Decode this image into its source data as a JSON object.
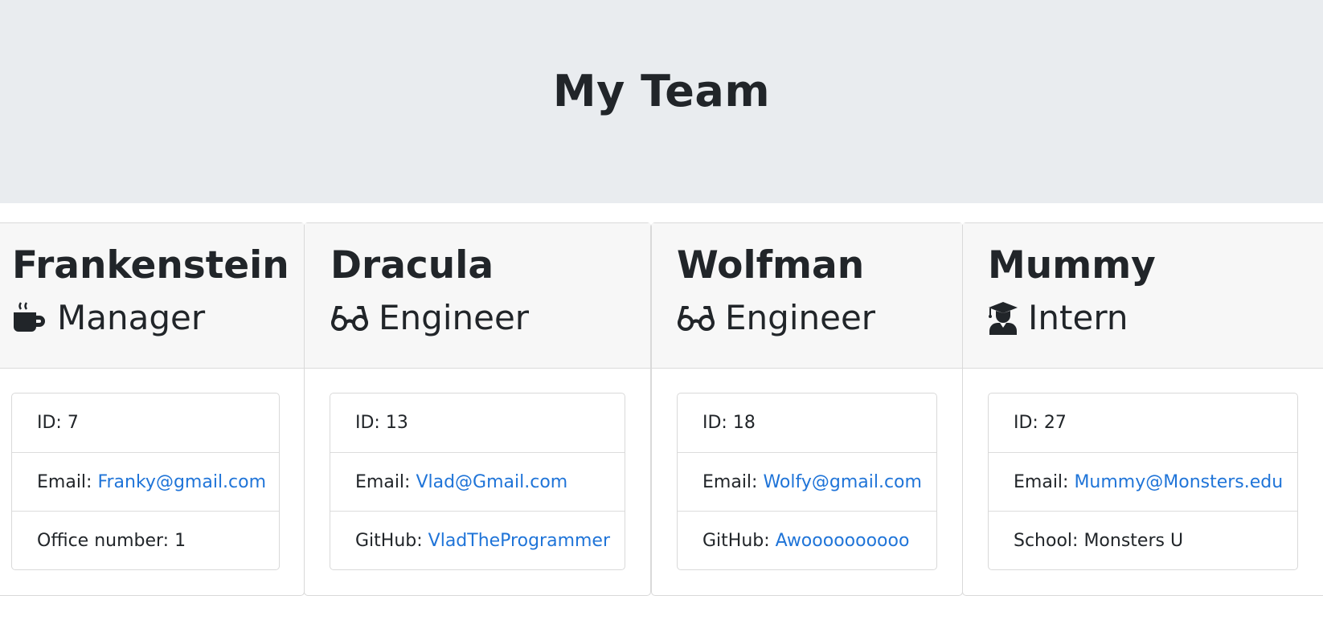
{
  "header": {
    "title": "My Team"
  },
  "employees": [
    {
      "name": "Frankenstein",
      "role": "Manager",
      "icon": "mug-icon",
      "id_text": "ID: 7",
      "email_label": "Email:",
      "email": "Franky@gmail.com",
      "extra_label": "Office number: 1",
      "extra_link": ""
    },
    {
      "name": "Dracula",
      "role": "Engineer",
      "icon": "glasses-icon",
      "id_text": "ID: 13",
      "email_label": "Email:",
      "email": "Vlad@Gmail.com",
      "extra_label": "GitHub:",
      "extra_link": "VladTheProgrammer"
    },
    {
      "name": "Wolfman",
      "role": "Engineer",
      "icon": "glasses-icon",
      "id_text": "ID: 18",
      "email_label": "Email:",
      "email": "Wolfy@gmail.com",
      "extra_label": "GitHub:",
      "extra_link": "Awoooooooooo"
    },
    {
      "name": "Mummy",
      "role": "Intern",
      "icon": "graduate-icon",
      "id_text": "ID: 27",
      "email_label": "Email:",
      "email": "Mummy@Monsters.edu",
      "extra_label": "School: Monsters U",
      "extra_link": ""
    }
  ],
  "colors": {
    "link": "#1f74d8",
    "jumbotron_bg": "#e9ecef",
    "card_header_bg": "#f7f7f7"
  }
}
